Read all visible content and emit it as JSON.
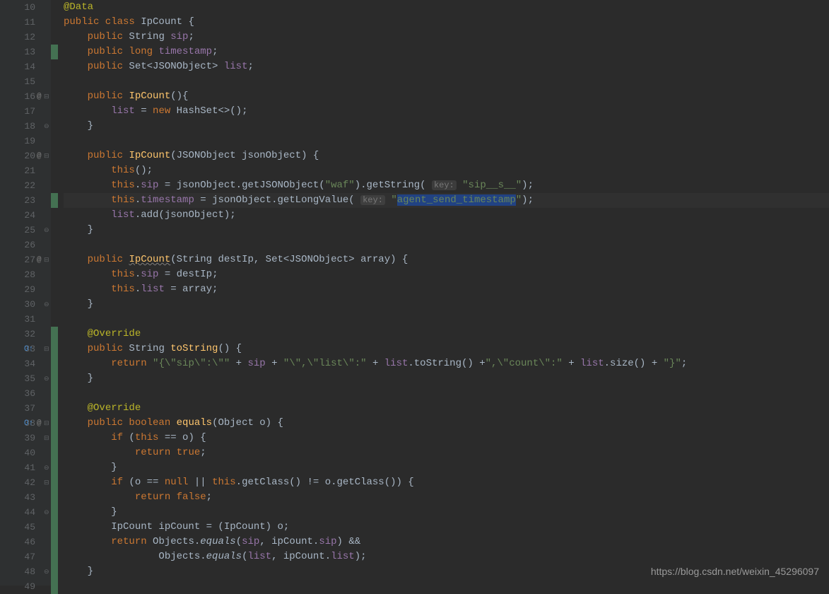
{
  "watermark": "https://blog.csdn.net/weixin_45296097",
  "lines": [
    {
      "n": 10,
      "icons": [],
      "marker": "",
      "html": "<span class='anno'>@Data</span>"
    },
    {
      "n": 11,
      "icons": [],
      "marker": "",
      "html": "<span class='kw'>public class</span> IpCount {"
    },
    {
      "n": 12,
      "icons": [],
      "marker": "",
      "html": "    <span class='kw'>public</span> String <span class='field'>sip</span>;"
    },
    {
      "n": 13,
      "icons": [],
      "marker": "green",
      "html": "    <span class='kw'>public long</span> <span class='field'>timestamp</span>;"
    },
    {
      "n": 14,
      "icons": [],
      "marker": "",
      "html": "    <span class='kw'>public</span> Set&lt;JSONObject&gt; <span class='field'>list</span>;"
    },
    {
      "n": 15,
      "icons": [],
      "marker": "",
      "html": ""
    },
    {
      "n": 16,
      "icons": [
        "at",
        "fold-down"
      ],
      "marker": "",
      "html": "    <span class='kw'>public</span> <span class='method'>IpCount</span>(){"
    },
    {
      "n": 17,
      "icons": [],
      "marker": "",
      "html": "        <span class='field'>list</span> = <span class='kw'>new</span> HashSet&lt;&gt;();"
    },
    {
      "n": 18,
      "icons": [
        "fold-up"
      ],
      "marker": "",
      "html": "    }"
    },
    {
      "n": 19,
      "icons": [],
      "marker": "",
      "html": ""
    },
    {
      "n": 20,
      "icons": [
        "at",
        "fold-down"
      ],
      "marker": "",
      "html": "    <span class='kw'>public</span> <span class='method'>IpCount</span>(JSONObject jsonObject) {"
    },
    {
      "n": 21,
      "icons": [],
      "marker": "",
      "html": "        <span class='kw'>this</span>();"
    },
    {
      "n": 22,
      "icons": [],
      "marker": "",
      "html": "        <span class='kw'>this</span>.<span class='field'>sip</span> = jsonObject.getJSONObject(<span class='str'>\"waf\"</span>).getString( <span class='hint'>key:</span> <span class='str'>\"sip__s__\"</span>);"
    },
    {
      "n": 23,
      "icons": [],
      "marker": "green",
      "current": true,
      "html": "        <span class='kw'>this</span>.<span class='field'>timestamp</span> = jsonObject.getLongValue( <span class='hint'>key:</span> <span class='str'>\"</span><span class='sel str'>agent_send_timestamp</span><span class='str'>\"</span>);"
    },
    {
      "n": 24,
      "icons": [],
      "marker": "",
      "html": "        <span class='field'>list</span>.add(jsonObject);"
    },
    {
      "n": 25,
      "icons": [
        "fold-up"
      ],
      "marker": "",
      "html": "    }"
    },
    {
      "n": 26,
      "icons": [],
      "marker": "",
      "html": ""
    },
    {
      "n": 27,
      "icons": [
        "at",
        "fold-down"
      ],
      "marker": "",
      "html": "    <span class='kw'>public</span> <span class='method underline'>IpCount</span>(String destIp, Set&lt;JSONObject&gt; array) {"
    },
    {
      "n": 28,
      "icons": [],
      "marker": "",
      "html": "        <span class='kw'>this</span>.<span class='field'>sip</span> = destIp;"
    },
    {
      "n": 29,
      "icons": [],
      "marker": "",
      "html": "        <span class='kw'>this</span>.<span class='field'>list</span> = array;"
    },
    {
      "n": 30,
      "icons": [
        "fold-up"
      ],
      "marker": "",
      "html": "    }"
    },
    {
      "n": 31,
      "icons": [],
      "marker": "",
      "html": ""
    },
    {
      "n": 32,
      "icons": [],
      "marker": "green",
      "html": "    <span class='anno'>@Override</span>"
    },
    {
      "n": 33,
      "icons": [
        "override",
        "fold-down"
      ],
      "marker": "green",
      "html": "    <span class='kw'>public</span> String <span class='method'>toString</span>() {"
    },
    {
      "n": 34,
      "icons": [],
      "marker": "green",
      "html": "        <span class='kw'>return</span> <span class='str'>\"{\\\"sip\\\":\\\"\"</span> + <span class='field'>sip</span> + <span class='str'>\"\\\",\\\"list\\\":\"</span> + <span class='field'>list</span>.toString() +<span class='str'>\",\\\"count\\\":\"</span> + <span class='field'>list</span>.size() + <span class='str'>\"}\"</span>;"
    },
    {
      "n": 35,
      "icons": [
        "fold-up"
      ],
      "marker": "green",
      "html": "    }"
    },
    {
      "n": 36,
      "icons": [],
      "marker": "green",
      "html": ""
    },
    {
      "n": 37,
      "icons": [],
      "marker": "green",
      "html": "    <span class='anno'>@Override</span>"
    },
    {
      "n": 38,
      "icons": [
        "override",
        "at",
        "fold-down"
      ],
      "marker": "green",
      "html": "    <span class='kw'>public boolean</span> <span class='method'>equals</span>(Object o) {"
    },
    {
      "n": 39,
      "icons": [
        "fold-down"
      ],
      "marker": "green",
      "html": "        <span class='kw'>if</span> (<span class='kw'>this</span> == o) {"
    },
    {
      "n": 40,
      "icons": [],
      "marker": "green",
      "html": "            <span class='kw'>return true</span>;"
    },
    {
      "n": 41,
      "icons": [
        "fold-up"
      ],
      "marker": "green",
      "html": "        }"
    },
    {
      "n": 42,
      "icons": [
        "fold-down"
      ],
      "marker": "green",
      "html": "        <span class='kw'>if</span> (o == <span class='kw'>null</span> || <span class='kw'>this</span>.getClass() != o.getClass()) {"
    },
    {
      "n": 43,
      "icons": [],
      "marker": "green",
      "html": "            <span class='kw'>return false</span>;"
    },
    {
      "n": 44,
      "icons": [
        "fold-up"
      ],
      "marker": "green",
      "html": "        }"
    },
    {
      "n": 45,
      "icons": [],
      "marker": "green",
      "html": "        IpCount ipCount = (IpCount) o;"
    },
    {
      "n": 46,
      "icons": [],
      "marker": "green",
      "html": "        <span class='kw'>return</span> Objects.<span style='font-style:italic'>equals</span>(<span class='field'>sip</span>, ipCount.<span class='field'>sip</span>) &amp;&amp;"
    },
    {
      "n": 47,
      "icons": [],
      "marker": "green",
      "html": "                Objects.<span style='font-style:italic'>equals</span>(<span class='field'>list</span>, ipCount.<span class='field'>list</span>);"
    },
    {
      "n": 48,
      "icons": [
        "fold-up"
      ],
      "marker": "green",
      "html": "    }"
    },
    {
      "n": 49,
      "icons": [],
      "marker": "green",
      "html": ""
    }
  ]
}
